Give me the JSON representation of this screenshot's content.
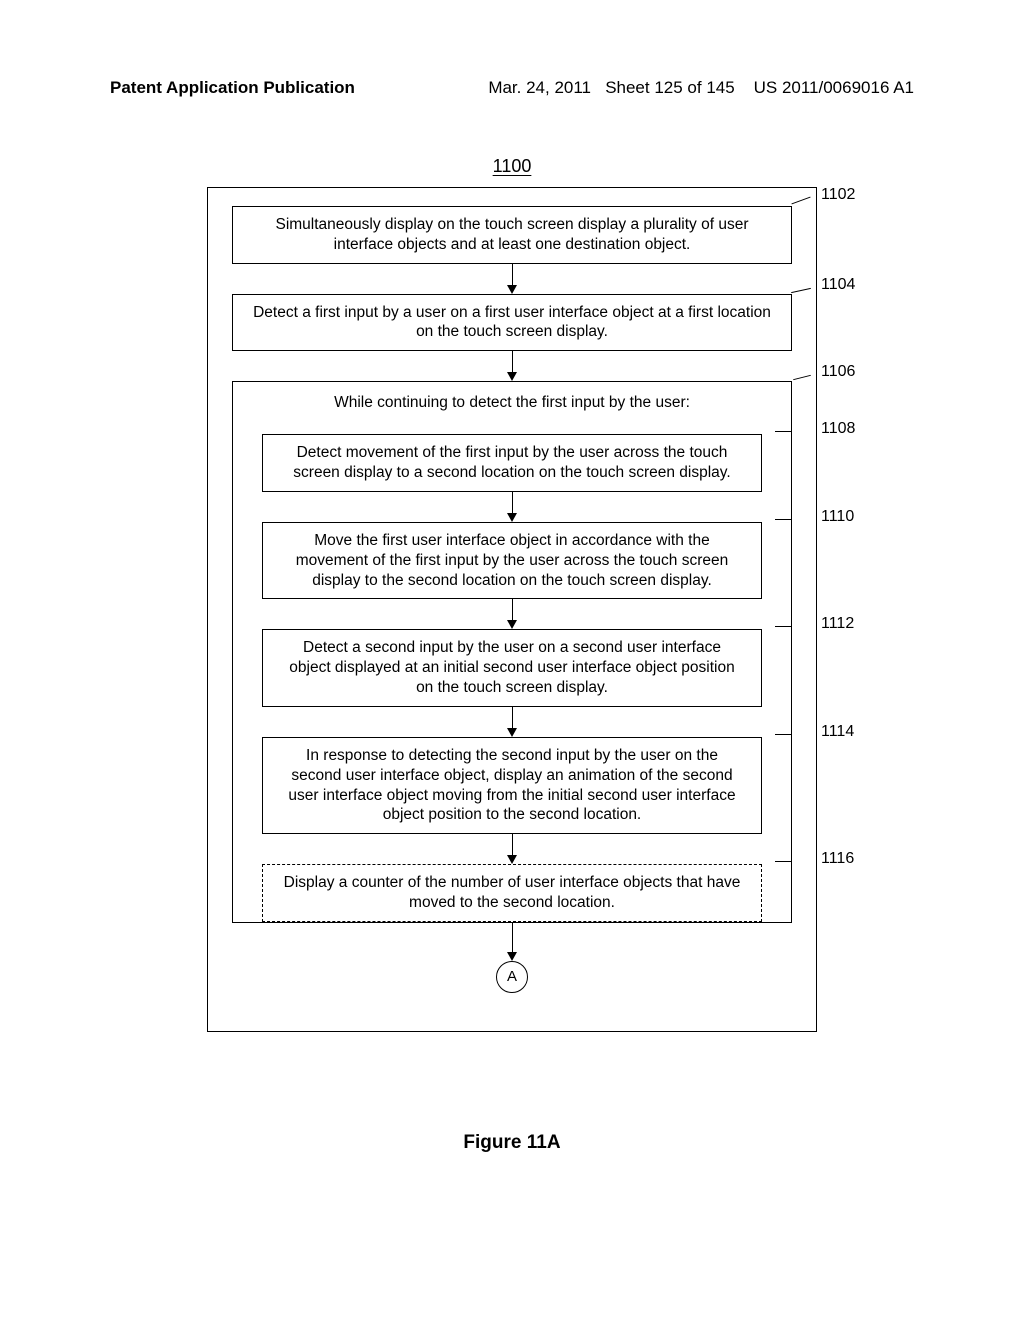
{
  "header": {
    "left": "Patent Application Publication",
    "date": "Mar. 24, 2011",
    "sheet": "Sheet 125 of 145",
    "pubno": "US 2011/0069016 A1"
  },
  "figure": {
    "number": "1100",
    "caption": "Figure 11A",
    "connector": "A"
  },
  "steps": {
    "s1102": {
      "ref": "1102",
      "text": "Simultaneously display on the touch screen display a plurality of user interface objects and at least one destination object."
    },
    "s1104": {
      "ref": "1104",
      "text": "Detect a first input by a user on a first user interface object at a first location on the touch screen display."
    },
    "s1106": {
      "ref": "1106",
      "header": "While continuing to detect the first input by the user:"
    },
    "s1108": {
      "ref": "1108",
      "text": "Detect movement of the first input by the user across the touch screen display to a second location on the touch screen display."
    },
    "s1110": {
      "ref": "1110",
      "text": "Move the first user interface object in accordance with the movement of the first input by the user across the touch screen display to the second location on the touch screen display."
    },
    "s1112": {
      "ref": "1112",
      "text": "Detect a second input by the user on a second user interface object displayed at an initial second user interface object position on the touch screen display."
    },
    "s1114": {
      "ref": "1114",
      "text": "In response to detecting the second input by the user on the second user interface object, display an animation of the second user interface object moving from the initial second user interface object position to the second location."
    },
    "s1116": {
      "ref": "1116",
      "text": "Display a counter of the number of user interface objects that have moved to the second location."
    }
  }
}
